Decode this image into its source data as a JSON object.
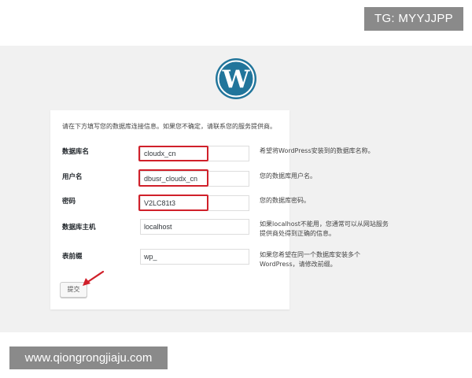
{
  "watermarks": {
    "top_right": "TG: MYYJJPP",
    "bottom_left": "www.qiongrongjiaju.com"
  },
  "logo": {
    "icon": "wordpress-logo-icon",
    "color": "#21759b"
  },
  "form": {
    "intro": "请在下方填写您的数据库连接信息。如果您不确定，请联系您的服务提供商。",
    "fields": [
      {
        "label": "数据库名",
        "value": "cloudx_cn",
        "description": [
          "希望将WordPress安装到的数据库名称。"
        ],
        "highlighted": true
      },
      {
        "label": "用户名",
        "value": "dbusr_cloudx_cn",
        "description": [
          "您的数据库用户名。"
        ],
        "highlighted": true
      },
      {
        "label": "密码",
        "value": "V2LC81t3",
        "description": [
          "您的数据库密码。"
        ],
        "highlighted": true
      },
      {
        "label": "数据库主机",
        "value": "localhost",
        "description": [
          "如果localhost不能用，您通常可以从网站服务",
          "提供商处得到正确的信息。"
        ],
        "highlighted": false
      },
      {
        "label": "表前缀",
        "value": "wp_",
        "description": [
          "如果您希望在同一个数据库安装多个",
          "WordPress，请修改前缀。"
        ],
        "highlighted": false
      }
    ],
    "submit_label": "提交"
  },
  "annotations": {
    "highlight_color": "#d0202a",
    "arrow_icon": "red-arrow-icon"
  }
}
